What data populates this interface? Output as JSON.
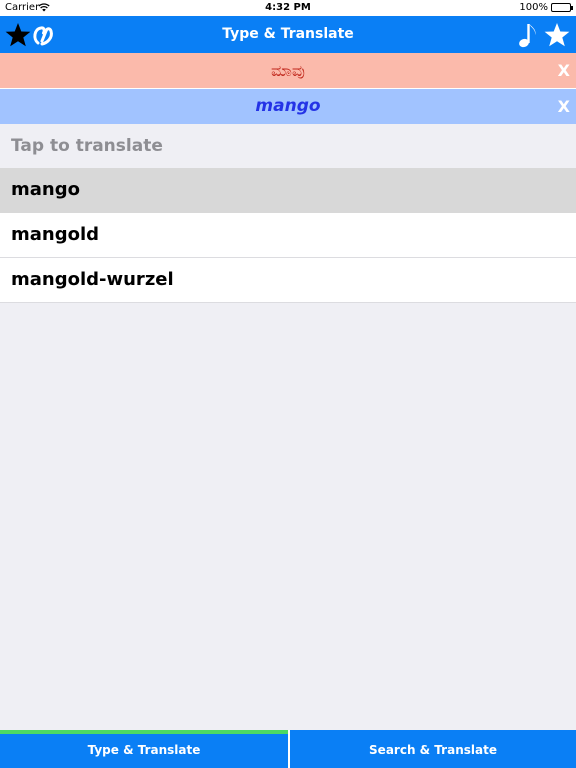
{
  "status_bar": {
    "carrier": "Carrier",
    "time": "4:32 PM",
    "battery": "100%"
  },
  "nav": {
    "title": "Type & Translate",
    "icons": [
      "star-icon",
      "logo-icon",
      "music-note-icon",
      "star-icon"
    ]
  },
  "source": {
    "text": "ಮಾವು",
    "clear_label": "X",
    "background": "#fbbaab",
    "text_color": "#c0271b"
  },
  "target": {
    "text": "mango",
    "clear_label": "X",
    "background": "#a1c3ff",
    "text_color": "#2433e6"
  },
  "list": {
    "header": "Tap to translate",
    "items": [
      {
        "label": "mango",
        "selected": true
      },
      {
        "label": "mangold",
        "selected": false
      },
      {
        "label": "mangold-wurzel",
        "selected": false
      }
    ]
  },
  "tabs": [
    {
      "label": "Type & Translate",
      "active": true
    },
    {
      "label": "Search & Translate",
      "active": false
    }
  ],
  "colors": {
    "accent": "#0a7ff5",
    "active_tab_indicator": "#4cd964"
  }
}
